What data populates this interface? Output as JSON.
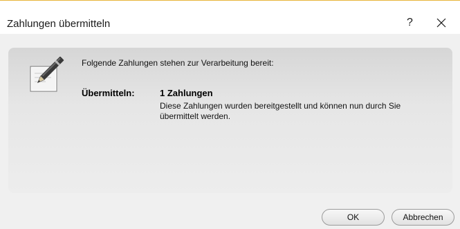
{
  "window": {
    "title": "Zahlungen übermitteln",
    "help_label": "?",
    "close_icon": "close-icon"
  },
  "dialog": {
    "icon": "pen-paper-icon",
    "intro": "Folgende Zahlungen stehen zur Verarbeitung bereit:",
    "label": "Übermitteln:",
    "value_title": "1 Zahlungen",
    "value_description": "Diese Zahlungen wurden bereitgestellt und können nun durch Sie übermittelt werden."
  },
  "buttons": {
    "ok": "OK",
    "cancel": "Abbrechen"
  },
  "colors": {
    "title_border": "#e8b53a",
    "content_bg": "#f0f0f0",
    "panel_bg": "#e6e6e6"
  }
}
